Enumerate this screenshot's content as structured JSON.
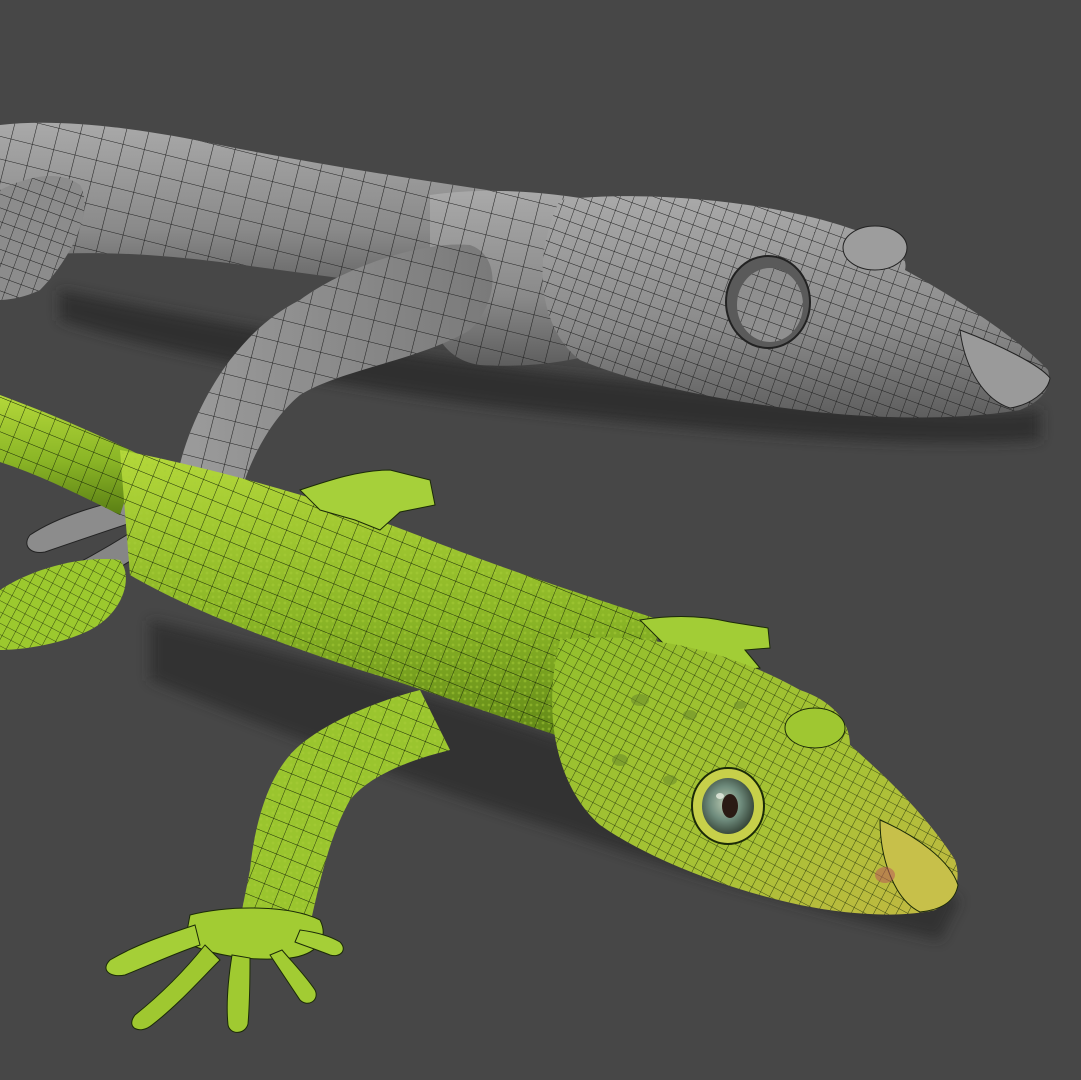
{
  "scene": {
    "background_color": "#474747",
    "models": [
      {
        "id": "gray-wireframe-lizard",
        "description_visible": false,
        "base_color": "#8e8e8e",
        "shade_color": "#6b6b6b",
        "highlight_color": "#b5b5b5",
        "wire_color": "#222222"
      },
      {
        "id": "green-textured-lizard",
        "description_visible": false,
        "base_color": "#8fbf2a",
        "shade_color": "#5f8a18",
        "highlight_color": "#c9e24a",
        "wire_color": "#1a2a08",
        "eye_color": "#6e8a7a",
        "pupil_color": "#2a1a14"
      }
    ]
  }
}
